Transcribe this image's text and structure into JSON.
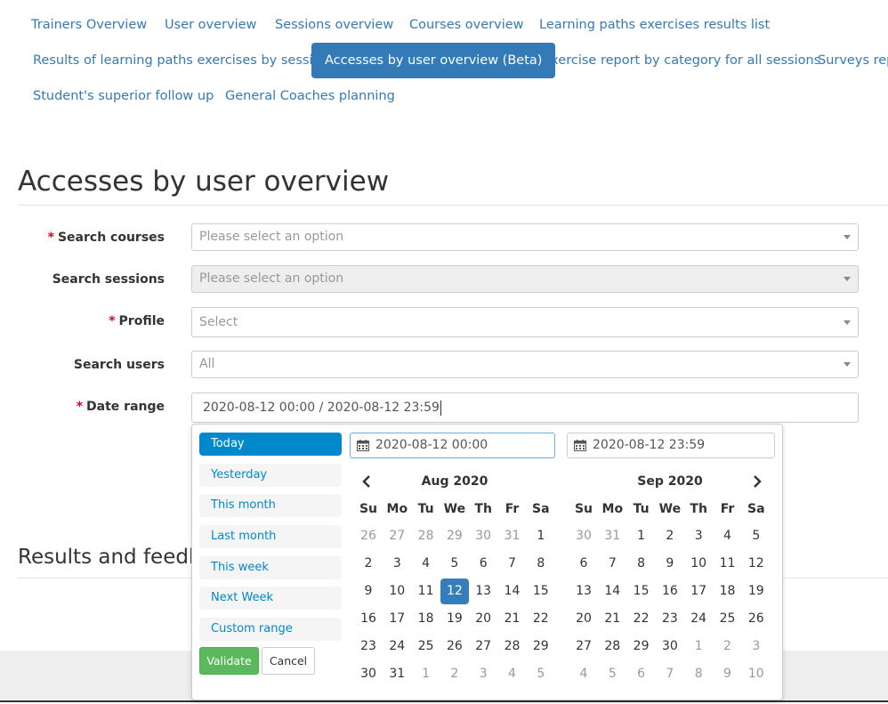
{
  "nav": {
    "row1": [
      "Trainers Overview",
      "User overview",
      "Sessions overview",
      "Courses overview",
      "Learning paths exercises results list"
    ],
    "row2": [
      "Results of learning paths exercises by session",
      "Accesses by user overview (Beta)",
      "Exercise report by category for all sessions",
      "Surveys report"
    ],
    "row3": [
      "Student's superior follow up",
      "General Coaches planning"
    ],
    "active": "Accesses by user overview (Beta)"
  },
  "page_title": "Accesses by user overview",
  "form": {
    "required_marker": "*",
    "search_courses": {
      "label": "Search courses",
      "placeholder": "Please select an option"
    },
    "search_sessions": {
      "label": "Search sessions",
      "placeholder": "Please select an option"
    },
    "profile": {
      "label": "Profile",
      "placeholder": "Select"
    },
    "search_users": {
      "label": "Search users",
      "placeholder": "All"
    },
    "date_range": {
      "label": "Date range",
      "value": "2020-08-12 00:00 / 2020-08-12 23:59"
    }
  },
  "results_title": "Results and feedback",
  "picker": {
    "ranges": [
      "Today",
      "Yesterday",
      "This month",
      "Last month",
      "This week",
      "Next Week",
      "Custom range"
    ],
    "active_range": "Today",
    "validate_label": "Validate",
    "cancel_label": "Cancel",
    "start_input": "2020-08-12 00:00",
    "end_input": "2020-08-12 23:59",
    "weekdays": [
      "Su",
      "Mo",
      "Tu",
      "We",
      "Th",
      "Fr",
      "Sa"
    ],
    "left_month": {
      "title": "Aug 2020",
      "weeks": [
        [
          "26",
          "27",
          "28",
          "29",
          "30",
          "31",
          "1"
        ],
        [
          "2",
          "3",
          "4",
          "5",
          "6",
          "7",
          "8"
        ],
        [
          "9",
          "10",
          "11",
          "12",
          "13",
          "14",
          "15"
        ],
        [
          "16",
          "17",
          "18",
          "19",
          "20",
          "21",
          "22"
        ],
        [
          "23",
          "24",
          "25",
          "26",
          "27",
          "28",
          "29"
        ],
        [
          "30",
          "31",
          "1",
          "2",
          "3",
          "4",
          "5"
        ]
      ],
      "off": [
        [
          0,
          0
        ],
        [
          0,
          1
        ],
        [
          0,
          2
        ],
        [
          0,
          3
        ],
        [
          0,
          4
        ],
        [
          0,
          5
        ],
        [
          5,
          2
        ],
        [
          5,
          3
        ],
        [
          5,
          4
        ],
        [
          5,
          5
        ],
        [
          5,
          6
        ]
      ],
      "active": [
        2,
        3
      ]
    },
    "right_month": {
      "title": "Sep 2020",
      "weeks": [
        [
          "30",
          "31",
          "1",
          "2",
          "3",
          "4",
          "5"
        ],
        [
          "6",
          "7",
          "8",
          "9",
          "10",
          "11",
          "12"
        ],
        [
          "13",
          "14",
          "15",
          "16",
          "17",
          "18",
          "19"
        ],
        [
          "20",
          "21",
          "22",
          "23",
          "24",
          "25",
          "26"
        ],
        [
          "27",
          "28",
          "29",
          "30",
          "1",
          "2",
          "3"
        ],
        [
          "4",
          "5",
          "6",
          "7",
          "8",
          "9",
          "10"
        ]
      ],
      "off": [
        [
          0,
          0
        ],
        [
          0,
          1
        ],
        [
          4,
          4
        ],
        [
          4,
          5
        ],
        [
          4,
          6
        ],
        [
          5,
          0
        ],
        [
          5,
          1
        ],
        [
          5,
          2
        ],
        [
          5,
          3
        ],
        [
          5,
          4
        ],
        [
          5,
          5
        ],
        [
          5,
          6
        ]
      ],
      "active": null
    }
  },
  "icons": {
    "calendar": "calendar-icon",
    "prev": "chevron-left-icon",
    "next": "chevron-right-icon",
    "dropdown": "caret-down-icon"
  },
  "colors": {
    "link": "#337ab7",
    "active_nav": "#337ab7",
    "picker_active": "#08c",
    "validate": "#5cb85c",
    "required": "#d9001b"
  }
}
